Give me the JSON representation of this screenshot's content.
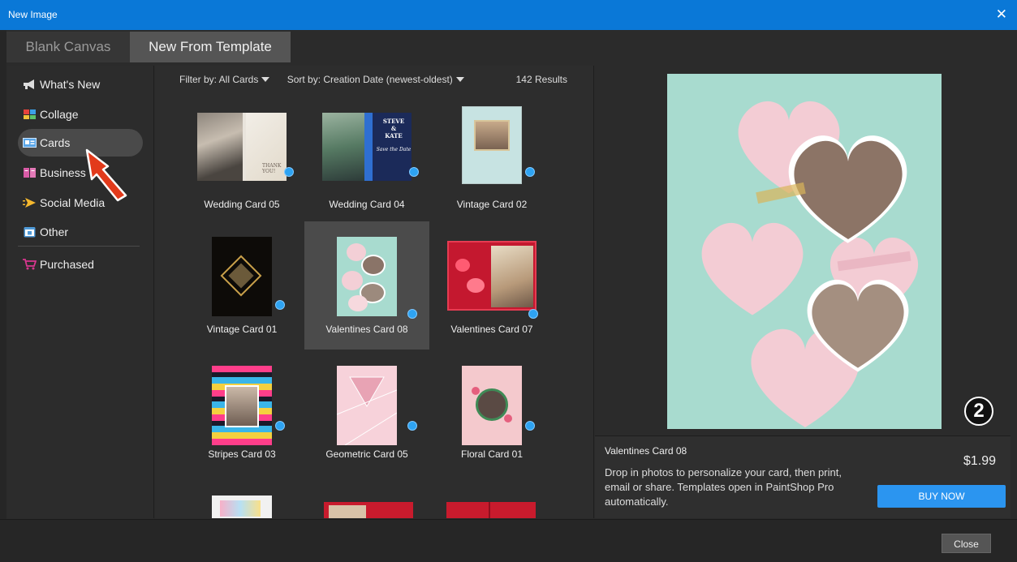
{
  "window": {
    "title": "New Image",
    "close_glyph": "✕"
  },
  "tabs": [
    {
      "label": "Blank Canvas"
    },
    {
      "label": "New From Template"
    }
  ],
  "sidebar": {
    "items": [
      {
        "label": "What's New",
        "icon": "megaphone-icon"
      },
      {
        "label": "Collage",
        "icon": "collage-icon"
      },
      {
        "label": "Cards",
        "icon": "card-icon",
        "active": true
      },
      {
        "label": "Business",
        "icon": "book-icon"
      },
      {
        "label": "Social Media",
        "icon": "social-icon"
      },
      {
        "label": "Other",
        "icon": "calendar-icon"
      },
      {
        "label": "Purchased",
        "icon": "cart-icon"
      }
    ]
  },
  "filters": {
    "filter_label": "Filter by: All Cards",
    "sort_label": "Sort by: Creation Date (newest-oldest)",
    "results": "142 Results"
  },
  "cards": [
    {
      "label": "Wedding Card 05"
    },
    {
      "label": "Wedding Card 04"
    },
    {
      "label": "Vintage Card 02"
    },
    {
      "label": "Vintage Card 01"
    },
    {
      "label": "Valentines Card 08",
      "selected": true
    },
    {
      "label": "Valentines Card 07"
    },
    {
      "label": "Stripes Card 03"
    },
    {
      "label": "Geometric Card 05"
    },
    {
      "label": "Floral Card 01"
    }
  ],
  "wedding04_text": {
    "line1": "STEVE",
    "line2": "&",
    "line3": "KATE",
    "line4": "Save the Date"
  },
  "wedding05_text": {
    "line1": "THANK",
    "line2": "YOU!"
  },
  "preview": {
    "name": "Valentines Card 08",
    "price": "$1.99",
    "description": "Drop in photos to personalize your card, then print, email or share. Templates open in PaintShop Pro automatically.",
    "buy_label": "BUY NOW",
    "step_badge": "2"
  },
  "footer": {
    "close_label": "Close"
  },
  "colors": {
    "accent": "#0a78d7",
    "dot": "#2ea3f2",
    "buy": "#2b95f0",
    "preview_bg": "#a8dbcf"
  }
}
